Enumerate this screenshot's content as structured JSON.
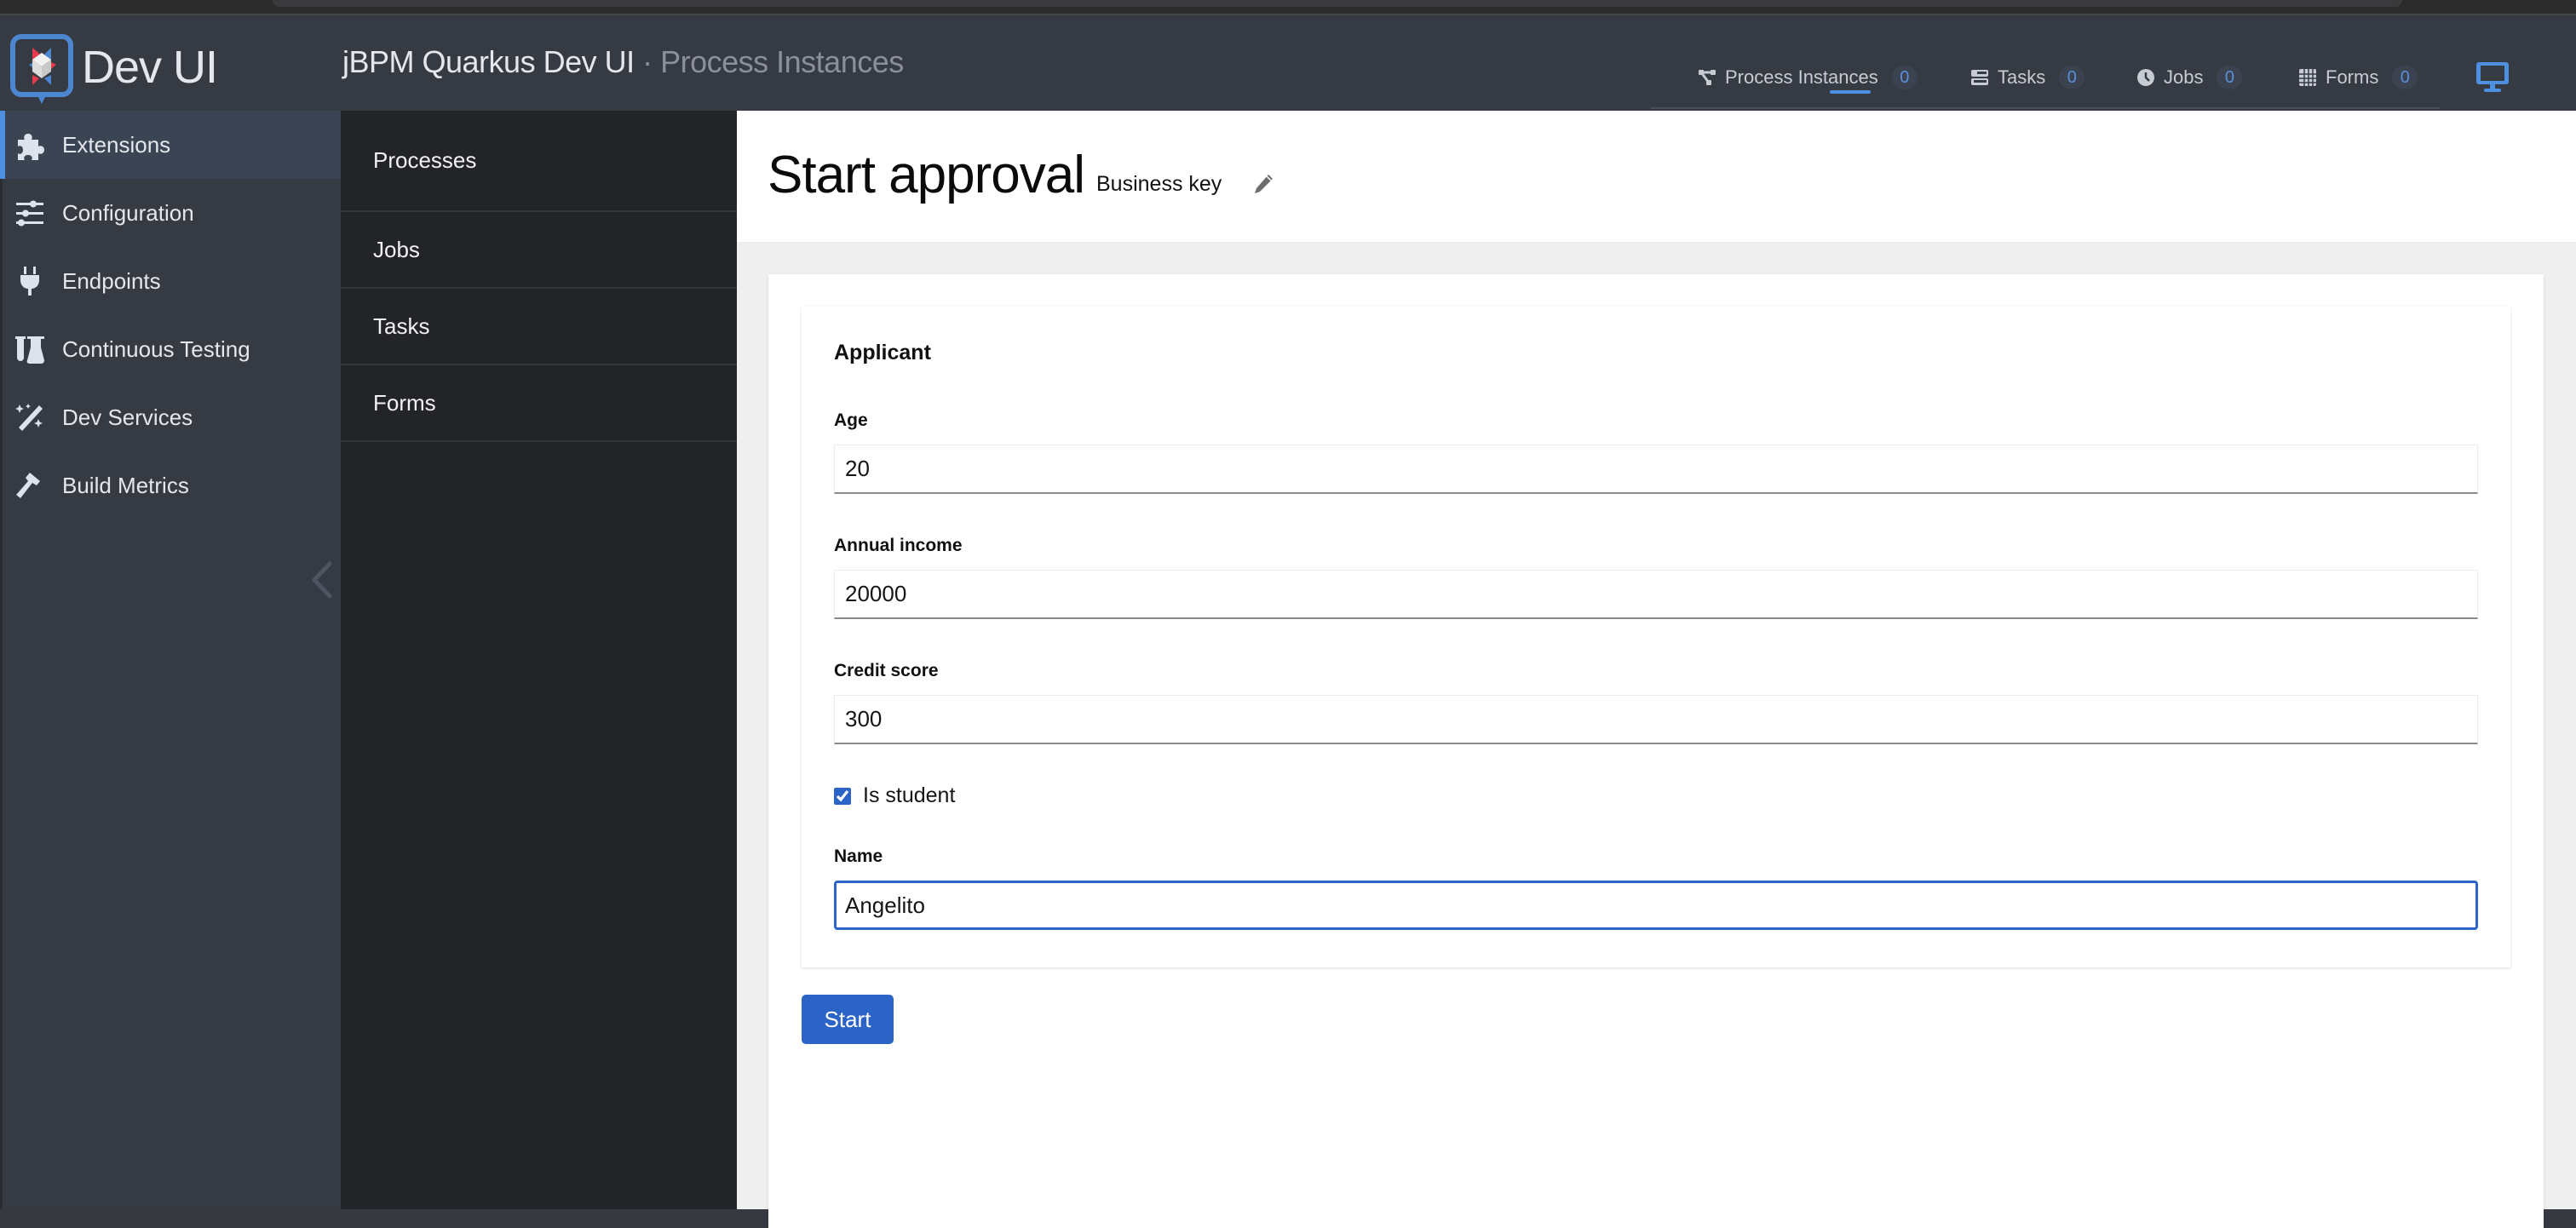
{
  "header": {
    "logo_text": "Dev UI",
    "app_title": "jBPM Quarkus Dev UI",
    "app_subtitle": "· Process Instances",
    "tabs": [
      {
        "label": "Process Instances",
        "count": "0",
        "icon": "topology-icon",
        "active": true
      },
      {
        "label": "Tasks",
        "count": "0",
        "icon": "tasks-icon"
      },
      {
        "label": "Jobs",
        "count": "0",
        "icon": "clock-icon"
      },
      {
        "label": "Forms",
        "count": "0",
        "icon": "table-icon"
      }
    ],
    "accent": "#4d8fe1"
  },
  "sidebar": {
    "items": [
      {
        "label": "Extensions",
        "icon": "puzzle-icon",
        "active": true
      },
      {
        "label": "Configuration",
        "icon": "sliders-icon"
      },
      {
        "label": "Endpoints",
        "icon": "plug-icon"
      },
      {
        "label": "Continuous Testing",
        "icon": "flask-icon"
      },
      {
        "label": "Dev Services",
        "icon": "magic-wand-icon"
      },
      {
        "label": "Build Metrics",
        "icon": "hammer-icon"
      }
    ]
  },
  "subnav": {
    "items": [
      {
        "label": "Processes"
      },
      {
        "label": "Jobs"
      },
      {
        "label": "Tasks"
      },
      {
        "label": "Forms"
      }
    ]
  },
  "page": {
    "title": "Start approval",
    "business_key_label": "Business key"
  },
  "form": {
    "section": "Applicant",
    "fields": [
      {
        "label": "Age",
        "value": "20"
      },
      {
        "label": "Annual income",
        "value": "20000"
      },
      {
        "label": "Credit score",
        "value": "300"
      },
      {
        "label": "Name",
        "value": "Angelito"
      }
    ],
    "checkbox": {
      "label": "Is student",
      "checked": true
    },
    "submit_label": "Start",
    "primary_color": "#2b64c6"
  }
}
